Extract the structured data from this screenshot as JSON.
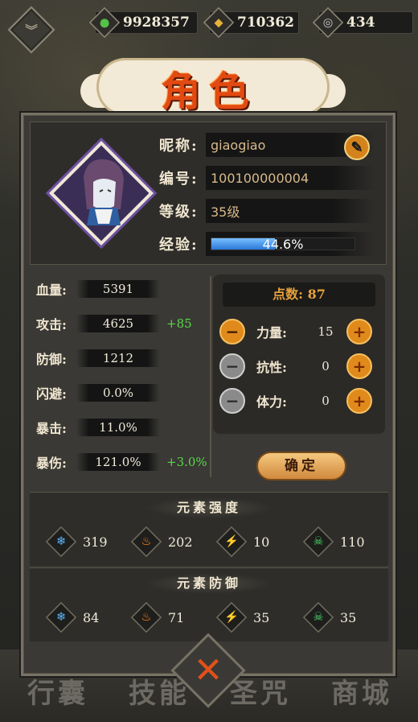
{
  "resources": [
    {
      "icon": "green-flame-icon",
      "value": "9928357",
      "color": "#54c248"
    },
    {
      "icon": "gold-coin-icon",
      "value": "710362",
      "color": "#e6b23a"
    },
    {
      "icon": "silver-swirl-icon",
      "value": "434",
      "color": "#c9c9c9"
    }
  ],
  "title": "角色",
  "profile": {
    "nickname_label": "昵称:",
    "nickname": "giaogiao",
    "id_label": "编号:",
    "id": "100100000004",
    "level_label": "等级:",
    "level": "35级",
    "exp_label": "经验:",
    "exp_text": "44.6%",
    "exp_fraction": 0.446
  },
  "stats": [
    {
      "label": "血量:",
      "value": "5391",
      "bonus": ""
    },
    {
      "label": "攻击:",
      "value": "4625",
      "bonus": "+85"
    },
    {
      "label": "防御:",
      "value": "1212",
      "bonus": ""
    },
    {
      "label": "闪避:",
      "value": "0.0%",
      "bonus": ""
    },
    {
      "label": "暴击:",
      "value": "11.0%",
      "bonus": ""
    },
    {
      "label": "暴伤:",
      "value": "121.0%",
      "bonus": "+3.0%"
    }
  ],
  "points": {
    "header": "点数: 87",
    "rows": [
      {
        "label": "力量:",
        "value": "15",
        "minus_active": true
      },
      {
        "label": "抗性:",
        "value": "0",
        "minus_active": false
      },
      {
        "label": "体力:",
        "value": "0",
        "minus_active": false
      }
    ],
    "minus_symbol": "−",
    "plus_symbol": "+",
    "confirm": "确定"
  },
  "element_strength": {
    "title": "元素强度",
    "items": [
      {
        "icon": "ice-icon",
        "glyph": "❄",
        "color": "#5ab8ff",
        "value": "319"
      },
      {
        "icon": "fire-icon",
        "glyph": "🔥",
        "color": "#ff8a1c",
        "value": "202"
      },
      {
        "icon": "lightning-icon",
        "glyph": "⚡",
        "color": "#b06cff",
        "value": "10"
      },
      {
        "icon": "poison-skull-icon",
        "glyph": "☠",
        "color": "#4ed86a",
        "value": "110"
      }
    ]
  },
  "element_defense": {
    "title": "元素防御",
    "items": [
      {
        "icon": "ice-icon",
        "glyph": "❄",
        "color": "#5ab8ff",
        "value": "84"
      },
      {
        "icon": "fire-icon",
        "glyph": "🔥",
        "color": "#ff8a1c",
        "value": "71"
      },
      {
        "icon": "lightning-icon",
        "glyph": "⚡",
        "color": "#b06cff",
        "value": "35"
      },
      {
        "icon": "poison-skull-icon",
        "glyph": "☠",
        "color": "#4ed86a",
        "value": "35"
      }
    ]
  },
  "bottom_tabs": [
    "行囊",
    "技能",
    "圣咒",
    "商城"
  ],
  "close_symbol": "✕"
}
